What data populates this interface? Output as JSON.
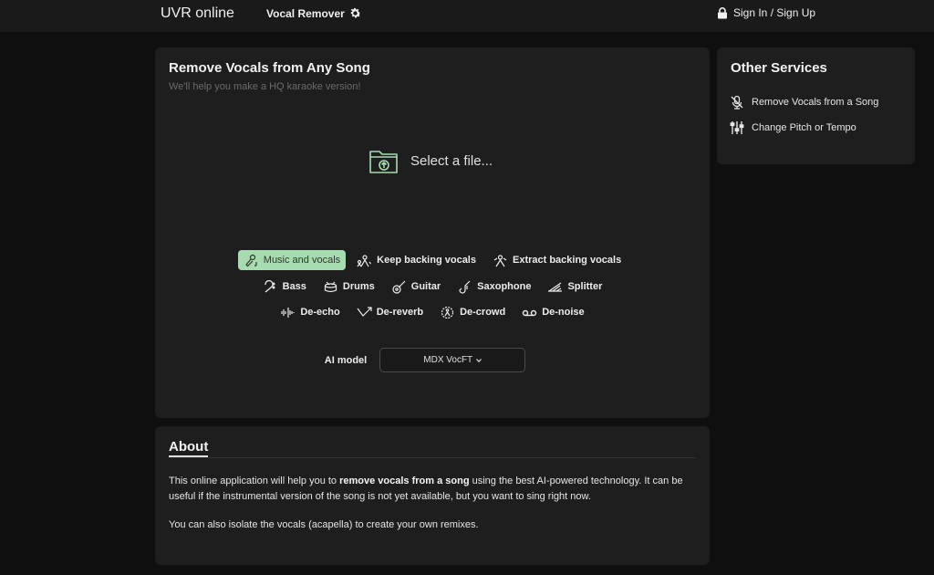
{
  "header": {
    "brand": "UVR online",
    "nav_vocal_remover": "Vocal Remover",
    "signin": "Sign In / Sign Up"
  },
  "main": {
    "title": "Remove Vocals from Any Song",
    "subtitle": "We'll help you make a HQ karaoke version!",
    "select_file": "Select a file...",
    "options_row1": [
      {
        "label": "Music and vocals",
        "icon": "mic-note-icon",
        "active": true
      },
      {
        "label": "Keep backing vocals",
        "icon": "backing-vocals-icon",
        "active": false
      },
      {
        "label": "Extract backing vocals",
        "icon": "extract-backing-icon",
        "active": false
      }
    ],
    "options_row2": [
      {
        "label": "Bass",
        "icon": "bass-clef-icon"
      },
      {
        "label": "Drums",
        "icon": "drums-icon"
      },
      {
        "label": "Guitar",
        "icon": "guitar-icon"
      },
      {
        "label": "Saxophone",
        "icon": "saxophone-icon"
      },
      {
        "label": "Splitter",
        "icon": "splitter-icon"
      }
    ],
    "options_row3": [
      {
        "label": "De-echo",
        "icon": "echo-icon"
      },
      {
        "label": "De-reverb",
        "icon": "reverb-icon"
      },
      {
        "label": "De-crowd",
        "icon": "crowd-icon"
      },
      {
        "label": "De-noise",
        "icon": "noise-icon"
      }
    ],
    "model_label": "AI model",
    "model_value": "MDX VocFT"
  },
  "sidebar": {
    "title": "Other Services",
    "services": [
      {
        "label": "Remove Vocals from a Song",
        "icon": "mic-off-icon"
      },
      {
        "label": "Change Pitch or Tempo",
        "icon": "sliders-icon"
      }
    ]
  },
  "about": {
    "title": "About",
    "p1_a": "This online application will help you to ",
    "p1_b": "remove vocals from a song",
    "p1_c": " using the best AI-powered technology. It can be useful if the instrumental version of the song is not yet available, but you want to sing right now.",
    "p2": "You can also isolate the vocals (acapella) to create your own remixes."
  },
  "colors": {
    "accent": "#a6dcb0",
    "background": "#0f0f0f",
    "card": "#1e1e1e"
  }
}
